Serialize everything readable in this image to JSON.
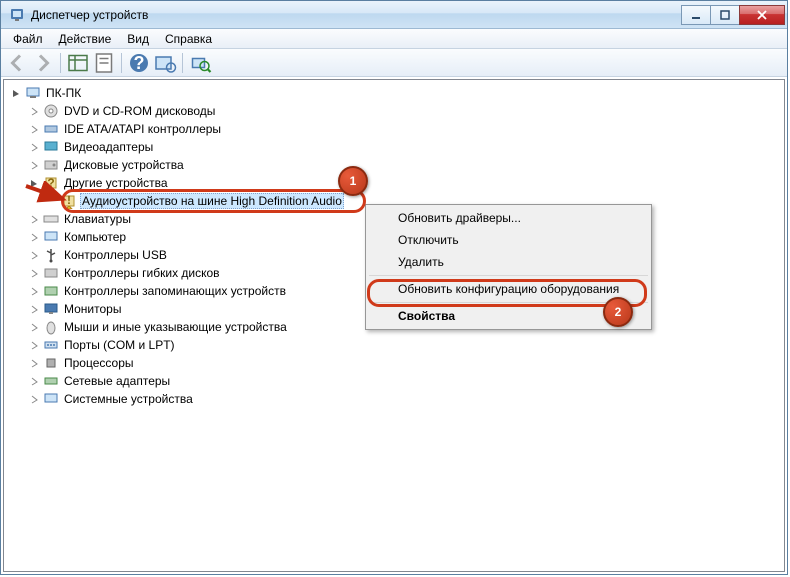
{
  "window": {
    "title": "Диспетчер устройств"
  },
  "menu": {
    "file": "Файл",
    "action": "Действие",
    "view": "Вид",
    "help": "Справка"
  },
  "tree": {
    "root": "ПК-ПК",
    "items": [
      "DVD и CD-ROM дисководы",
      "IDE ATA/ATAPI контроллеры",
      "Видеоадаптеры",
      "Дисковые устройства",
      "Другие устройства",
      "Клавиатуры",
      "Компьютер",
      "Контроллеры USB",
      "Контроллеры гибких дисков",
      "Контроллеры запоминающих устройств",
      "Мониторы",
      "Мыши и иные указывающие устройства",
      "Порты (COM и LPT)",
      "Процессоры",
      "Сетевые адаптеры",
      "Системные устройства"
    ],
    "other_child": "Аудиоустройство на шине High Definition Audio"
  },
  "context_menu": {
    "update_drivers": "Обновить драйверы...",
    "disable": "Отключить",
    "delete": "Удалить",
    "scan_hardware": "Обновить конфигурацию оборудования",
    "properties": "Свойства"
  },
  "annotations": {
    "badge1": "1",
    "badge2": "2"
  }
}
